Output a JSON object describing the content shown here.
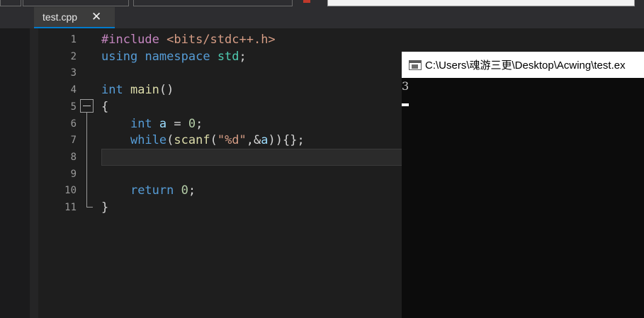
{
  "tab": {
    "title": "test.cpp",
    "close_glyph": "✕"
  },
  "editor": {
    "lines": [
      {
        "n": "1",
        "html": "<span class=\"pp\">#include</span> <span class=\"hdr\">&lt;bits/stdc++.h&gt;</span>"
      },
      {
        "n": "2",
        "html": "<span class=\"kw\">using</span> <span class=\"kw\">namespace</span> <span class=\"ns\">std</span>;"
      },
      {
        "n": "3",
        "html": ""
      },
      {
        "n": "4",
        "html": "<span class=\"kw\">int</span> <span class=\"fn\">main</span>()"
      },
      {
        "n": "5",
        "html": "{"
      },
      {
        "n": "6",
        "html": "    <span class=\"kw\">int</span> <span class=\"id\">a</span> = <span class=\"num\">0</span>;"
      },
      {
        "n": "7",
        "html": "    <span class=\"kw\">while</span>(<span class=\"fn\">scanf</span>(<span class=\"str\">\"%d\"</span>,&amp;<span class=\"id\">a</span>)){};"
      },
      {
        "n": "8",
        "html": ""
      },
      {
        "n": "9",
        "html": ""
      },
      {
        "n": "10",
        "html": "    <span class=\"kw\">return</span> <span class=\"num\">0</span>;"
      },
      {
        "n": "11",
        "html": "}"
      }
    ]
  },
  "console": {
    "title": "C:\\Users\\魂游三更\\Desktop\\Acwing\\test.ex",
    "output": "3"
  }
}
